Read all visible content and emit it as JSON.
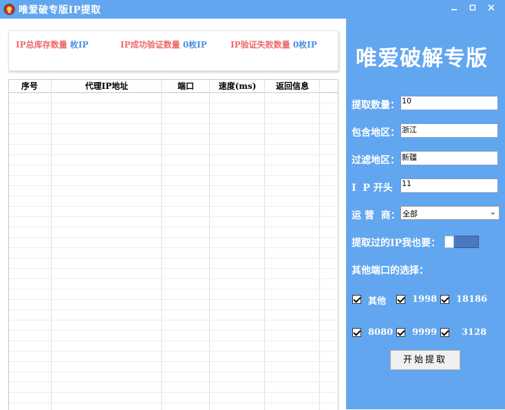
{
  "window": {
    "title": "唯爱破专版IP提取",
    "minimize": "▬",
    "maximize": "☐",
    "close": "✕",
    "icon": "app-logo-icon"
  },
  "stats": {
    "total_label": "IP总库存数量",
    "total_value": "枚IP",
    "success_label": "IP成功验证数量",
    "success_value": "0枚IP",
    "fail_label": "IP验证失败数量",
    "fail_value": "0枚IP"
  },
  "table": {
    "columns": [
      "序号",
      "代理IP地址",
      "端口",
      "速度(ms)",
      "返回信息"
    ],
    "rows": []
  },
  "panel": {
    "brand": "唯爱破解专版",
    "count_label": "提取数量：",
    "count_value": "10",
    "include_label": "包含地区：",
    "include_value": "浙江",
    "exclude_label": "过滤地区：",
    "exclude_value": "新疆",
    "prefix_label": "I  P 开头",
    "prefix_value": "11",
    "isp_label": "运 营  商：",
    "isp_value": "全部",
    "reuse_label": "提取过的IP我也要：",
    "ports_label": "其他端口的选择：",
    "ports": [
      "其他",
      "1998",
      "18186",
      "8080",
      "9999",
      "3128"
    ],
    "start_button": "开始提取"
  },
  "colors": {
    "accent": "#62a6ef",
    "stat_label": "#ee6a6a",
    "stat_value": "#4a90e2",
    "toggle": "#4c78bf"
  }
}
